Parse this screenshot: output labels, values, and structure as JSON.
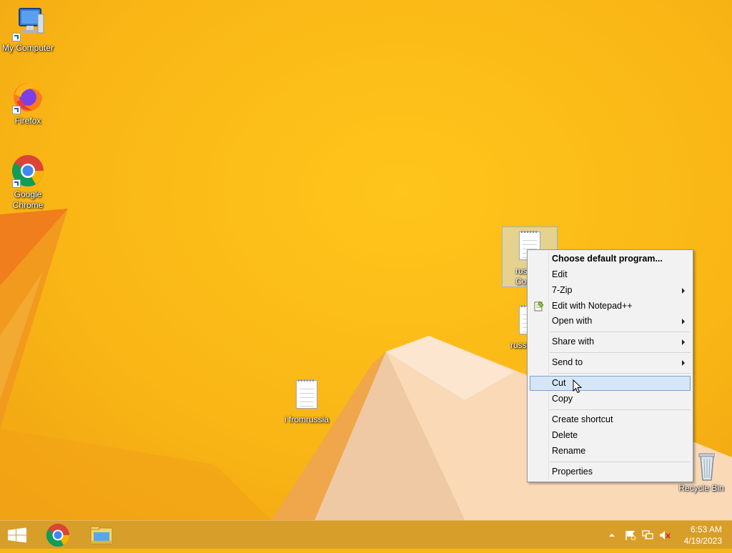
{
  "desktop": {
    "icons": [
      {
        "label": "My Computer"
      },
      {
        "label": "Firefox"
      },
      {
        "label": "Google Chrome"
      },
      {
        "label": "russia Co"
      },
      {
        "label": "russi"
      },
      {
        "label": "i fromrussia"
      },
      {
        "label": "Recycle Bin"
      }
    ]
  },
  "context_menu": {
    "items": [
      {
        "label": "Choose default program..."
      },
      {
        "label": "Edit"
      },
      {
        "label": "7-Zip"
      },
      {
        "label": "Edit with Notepad++"
      },
      {
        "label": "Open with"
      },
      {
        "label": "Share with"
      },
      {
        "label": "Send to"
      },
      {
        "label": "Cut"
      },
      {
        "label": "Copy"
      },
      {
        "label": "Create shortcut"
      },
      {
        "label": "Delete"
      },
      {
        "label": "Rename"
      },
      {
        "label": "Properties"
      }
    ]
  },
  "taskbar": {
    "time": "6:53 AM",
    "date": "4/19/2023"
  },
  "colors": {
    "wallpaper": "#F8B614",
    "menu_hover": "#D5E6F7",
    "taskbar": "#D89E2A"
  }
}
